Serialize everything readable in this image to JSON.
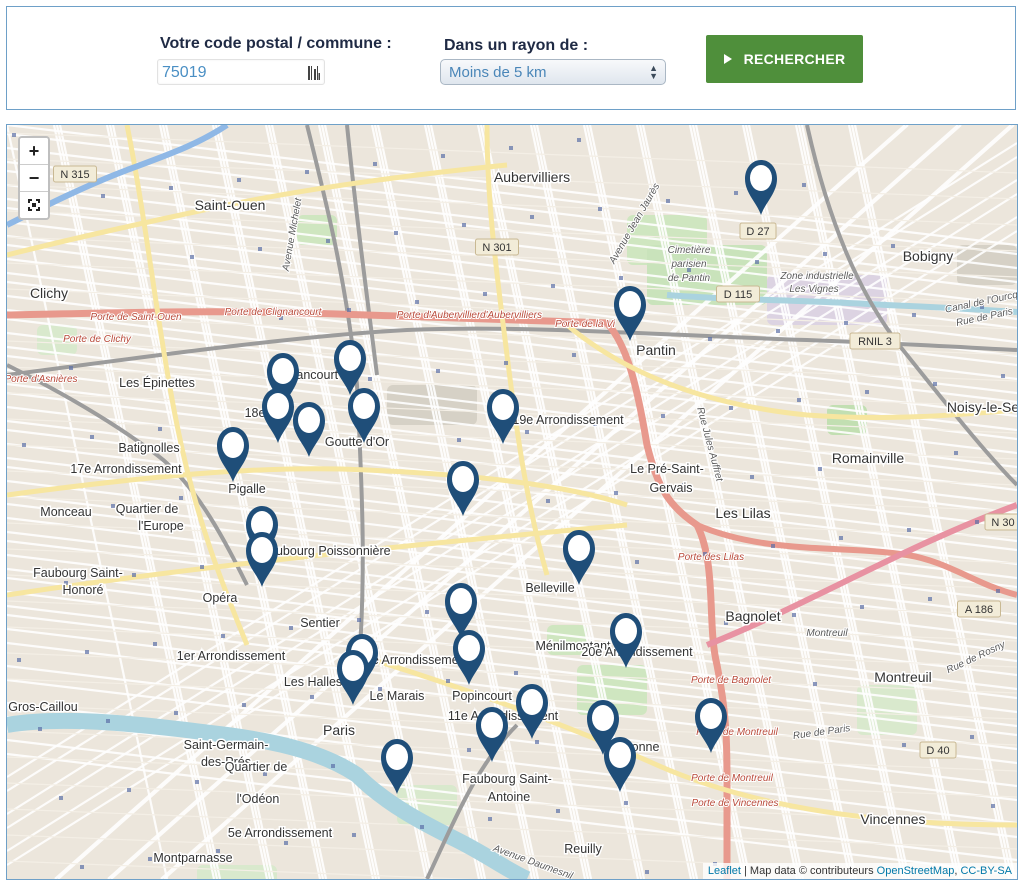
{
  "search": {
    "postal_label": "Votre code postal / commune :",
    "postal_value": "75019",
    "radius_label": "Dans un rayon de :",
    "radius_value": "Moins de 5 km",
    "button_label": "RECHERCHER"
  },
  "map_controls": {
    "zoom_in": "+",
    "zoom_out": "−",
    "fullscreen_icon": "fullscreen-icon"
  },
  "attribution": {
    "leaflet": "Leaflet",
    "separator": " | Map data © contributeurs ",
    "osm": "OpenStreetMap",
    "comma": ", ",
    "license": "CC-BY-SA"
  },
  "colors": {
    "accent": "#4f8f3b",
    "marker": "#1f4e79",
    "panel_border": "#6ea0c8",
    "input_text": "#4a8fc4"
  },
  "map": {
    "places": [
      {
        "name": "place-aubervilliers",
        "label": "Aubervilliers",
        "big": true
      },
      {
        "name": "place-saint-ouen",
        "label": "Saint-Ouen",
        "big": true
      },
      {
        "name": "place-bobigny",
        "label": "Bobigny",
        "big": true
      },
      {
        "name": "place-clichy",
        "label": "Clichy",
        "big": true
      },
      {
        "name": "place-pantin",
        "label": "Pantin",
        "big": true
      },
      {
        "name": "place-noisy",
        "label": "Noisy-le-Se",
        "big": true
      },
      {
        "name": "place-epinettes",
        "label": "Les Épinettes"
      },
      {
        "name": "place-clignancourt",
        "label": "Clignancourt"
      },
      {
        "name": "place-18e",
        "label": "18e"
      },
      {
        "name": "place-goutte-dor",
        "label": "Goutte d'Or"
      },
      {
        "name": "place-19e",
        "label": "19e Arrondissement"
      },
      {
        "name": "place-batignolles",
        "label": "Batignolles"
      },
      {
        "name": "place-17e",
        "label": "17e Arrondissement"
      },
      {
        "name": "place-pigalle",
        "label": "Pigalle"
      },
      {
        "name": "place-romainville",
        "label": "Romainville",
        "big": true
      },
      {
        "name": "place-pre-saint-gervais",
        "label": "Le Pré-Saint-"
      },
      {
        "name": "place-gervais",
        "label": "Gervais"
      },
      {
        "name": "place-monceau",
        "label": "Monceau"
      },
      {
        "name": "place-quartier-europe",
        "label": "Quartier de"
      },
      {
        "name": "place-europe",
        "label": "l'Europe"
      },
      {
        "name": "place-faubourg-poissonniere",
        "label": "Faubourg Poissonnière"
      },
      {
        "name": "place-les-lilas",
        "label": "Les Lilas",
        "big": true
      },
      {
        "name": "place-faubourg-st-honore",
        "label": "Faubourg Saint-"
      },
      {
        "name": "place-honore",
        "label": "Honoré"
      },
      {
        "name": "place-opera",
        "label": "Opéra"
      },
      {
        "name": "place-belleville",
        "label": "Belleville"
      },
      {
        "name": "place-bagnolet",
        "label": "Bagnolet",
        "big": true
      },
      {
        "name": "place-menilmontant",
        "label": "Ménilmontant"
      },
      {
        "name": "place-sentier",
        "label": "Sentier"
      },
      {
        "name": "place-20e",
        "label": "20e Arrondissement"
      },
      {
        "name": "place-1er",
        "label": "1er Arrondissement"
      },
      {
        "name": "place-3e",
        "label": "3e Arrondissement"
      },
      {
        "name": "place-halles",
        "label": "Les Halles"
      },
      {
        "name": "place-marais",
        "label": "Le Marais"
      },
      {
        "name": "place-popincourt",
        "label": "Popincourt"
      },
      {
        "name": "place-montreuil",
        "label": "Montreuil",
        "big": true
      },
      {
        "name": "place-gros-caillou",
        "label": "Gros-Caillou"
      },
      {
        "name": "place-11e",
        "label": "11e Arrondissement"
      },
      {
        "name": "place-paris",
        "label": "Paris",
        "big": true
      },
      {
        "name": "place-charonne",
        "label": "Charonne"
      },
      {
        "name": "place-sg-pres-1",
        "label": "Saint-Germain-"
      },
      {
        "name": "place-sg-pres-2",
        "label": "des-Prés"
      },
      {
        "name": "place-odeon-1",
        "label": "Quartier de"
      },
      {
        "name": "place-odeon-2",
        "label": "l'Odéon"
      },
      {
        "name": "place-fsa-1",
        "label": "Faubourg Saint-"
      },
      {
        "name": "place-fsa-2",
        "label": "Antoine"
      },
      {
        "name": "place-5e",
        "label": "5e Arrondissement"
      },
      {
        "name": "place-vincennes",
        "label": "Vincennes",
        "big": true
      },
      {
        "name": "place-montparnasse",
        "label": "Montparnasse"
      },
      {
        "name": "place-reuilly",
        "label": "Reuilly"
      }
    ],
    "road_labels": [
      {
        "name": "road-n315",
        "label": "N 315"
      },
      {
        "name": "road-n301",
        "label": "N 301"
      },
      {
        "name": "road-d27",
        "label": "D 27"
      },
      {
        "name": "road-d115",
        "label": "D 115"
      },
      {
        "name": "road-rnil3",
        "label": "RNIL 3"
      },
      {
        "name": "road-n302",
        "label": "N 30"
      },
      {
        "name": "road-a186",
        "label": "A 186"
      },
      {
        "name": "road-d40",
        "label": "D 40"
      }
    ],
    "street_labels": [
      {
        "name": "street-porte-saint-ouen",
        "label": "Porte de Saint-Ouen"
      },
      {
        "name": "street-porte-clignancourt",
        "label": "Porte de Clignancourt"
      },
      {
        "name": "street-porte-aubervilliers",
        "label": "Porte d'Aubervilliers"
      },
      {
        "name": "street-porte-aubervilliers-2",
        "label": "d'Aubervilliers"
      },
      {
        "name": "street-porte-villette",
        "label": "Porte de la Vi"
      },
      {
        "name": "street-porte-clichy",
        "label": "Porte de Clichy"
      },
      {
        "name": "street-porte-asnieres",
        "label": "Porte d'Asnières"
      },
      {
        "name": "street-porte-lilas",
        "label": "Porte des Lilas"
      },
      {
        "name": "street-porte-bagnolet",
        "label": "Porte de Bagnolet"
      },
      {
        "name": "street-porte-montreuil",
        "label": "Porte de Montreuil"
      },
      {
        "name": "street-porte-montreuil-2",
        "label": "Porte de Montreuil"
      },
      {
        "name": "street-porte-vincennes",
        "label": "Porte de Vincennes"
      },
      {
        "name": "street-cimetiere-1",
        "label": "Cimetière"
      },
      {
        "name": "street-cimetiere-2",
        "label": "parisien"
      },
      {
        "name": "street-cimetiere-3",
        "label": "de Pantin"
      },
      {
        "name": "street-zone-1",
        "label": "Zone industrielle"
      },
      {
        "name": "street-zone-2",
        "label": "Les Vignes"
      },
      {
        "name": "street-canal",
        "label": "Canal de l'Ourcq"
      },
      {
        "name": "street-rue-paris",
        "label": "Rue de Paris"
      },
      {
        "name": "street-rue-paris-2",
        "label": "Rue de Paris"
      },
      {
        "name": "street-avenue-michelet",
        "label": "Avenue Michelet"
      },
      {
        "name": "street-jean-jaures",
        "label": "Avenue Jean Jaurès"
      },
      {
        "name": "street-jules-auffret",
        "label": "Rue Jules Auffret"
      },
      {
        "name": "street-rosny",
        "label": "Rue de Rosny"
      },
      {
        "name": "street-montreuil-road",
        "label": "Montreuil"
      },
      {
        "name": "street-daumesnil",
        "label": "Avenue Daumesnil"
      }
    ],
    "markers": [
      {
        "name": "marker-pantin-north"
      },
      {
        "name": "marker-pantin"
      },
      {
        "name": "marker-clignancourt"
      },
      {
        "name": "marker-18e-a"
      },
      {
        "name": "marker-18e-b"
      },
      {
        "name": "marker-18e-c"
      },
      {
        "name": "marker-goutte-dor-a"
      },
      {
        "name": "marker-goutte-dor-b"
      },
      {
        "name": "marker-19e"
      },
      {
        "name": "marker-pigalle"
      },
      {
        "name": "marker-10e"
      },
      {
        "name": "marker-faubourg-poissonniere"
      },
      {
        "name": "marker-belleville"
      },
      {
        "name": "marker-faubourg-temple"
      },
      {
        "name": "marker-20e"
      },
      {
        "name": "marker-3e-a"
      },
      {
        "name": "marker-3e-b"
      },
      {
        "name": "marker-popincourt"
      },
      {
        "name": "marker-11e-a"
      },
      {
        "name": "marker-11e-b"
      },
      {
        "name": "marker-charonne-a"
      },
      {
        "name": "marker-charonne-b"
      },
      {
        "name": "marker-porte-montreuil"
      },
      {
        "name": "marker-faubourg-st-antoine"
      }
    ]
  }
}
